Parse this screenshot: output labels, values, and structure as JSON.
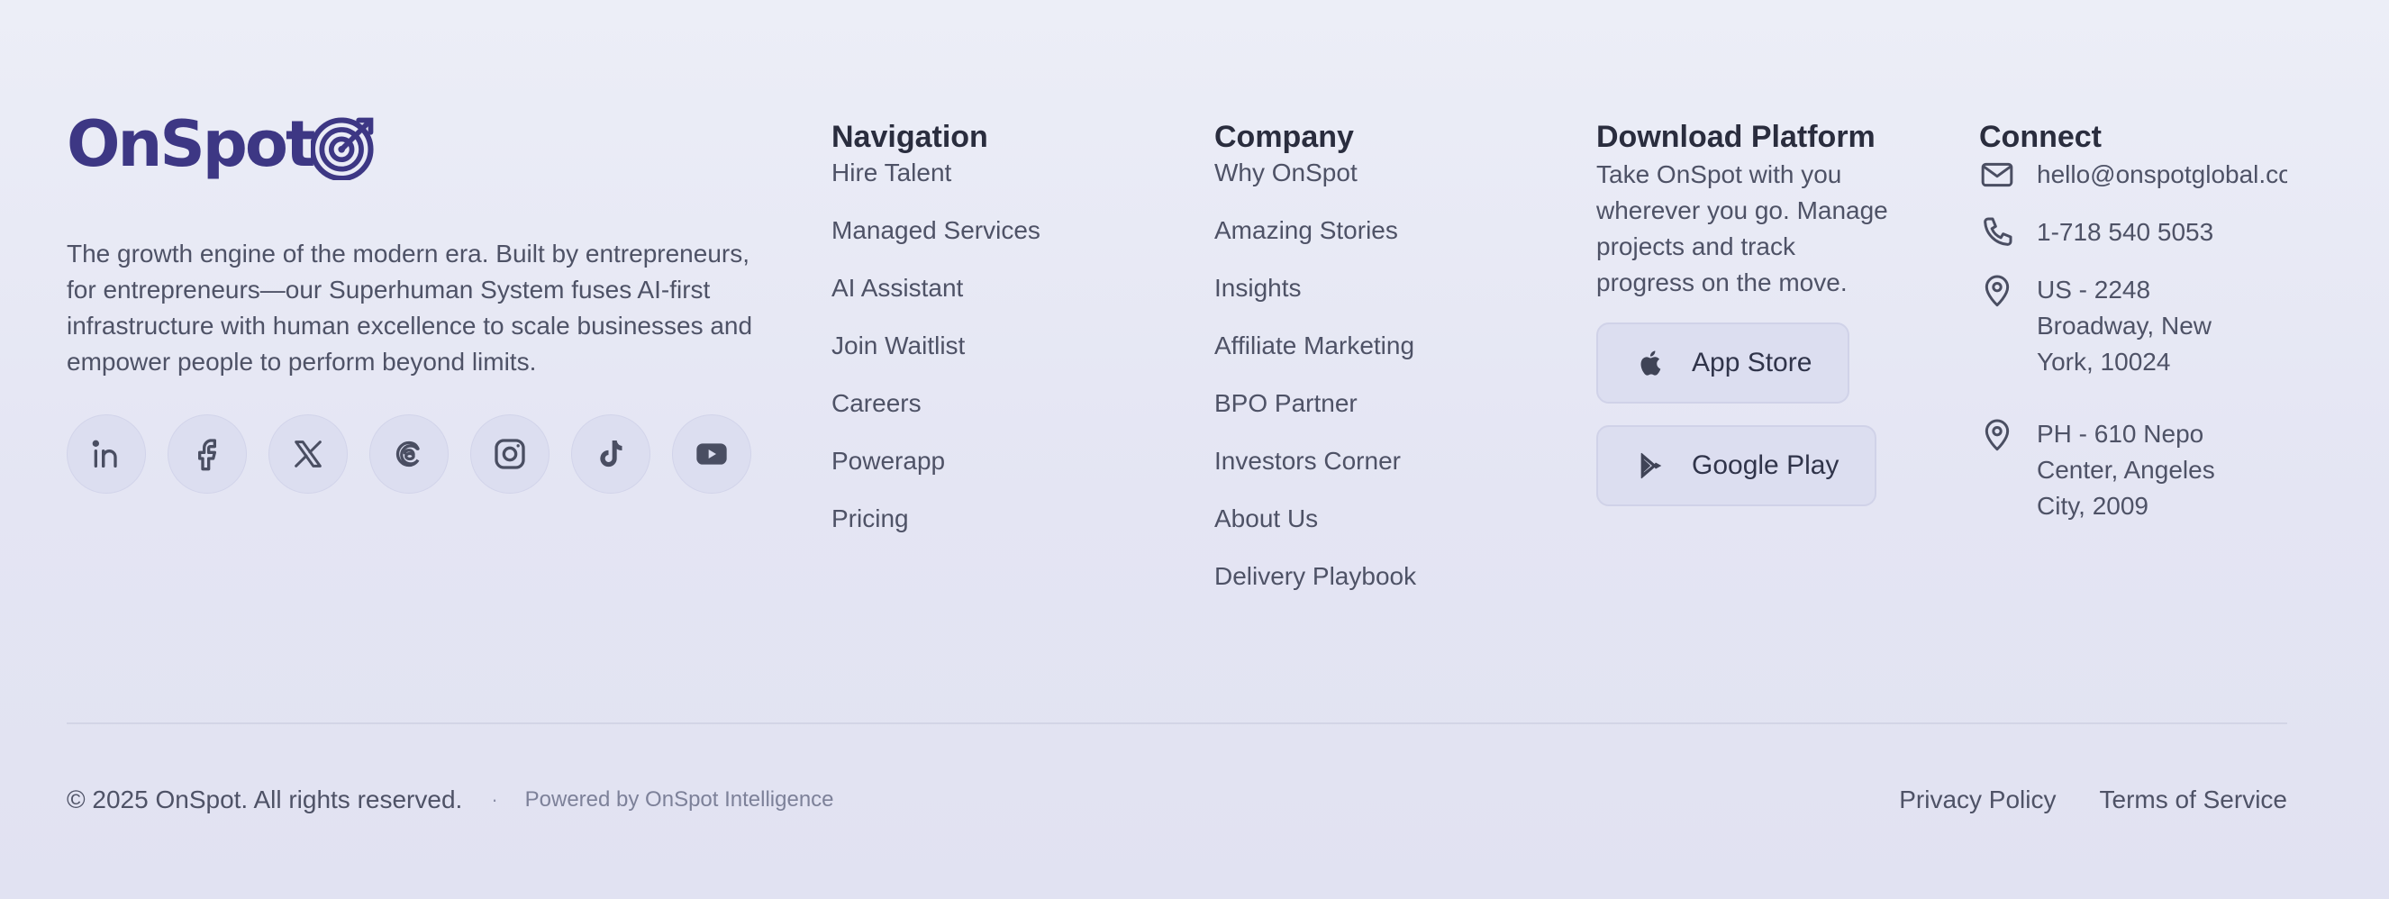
{
  "brand": {
    "logo_text": "OnSpot",
    "logo_color": "#3d3784",
    "tagline": "The growth engine of the modern era. Built by entrepreneurs, for entrepreneurs—our Superhuman System fuses AI-first infrastructure with human excellence to scale businesses and empower people to perform beyond limits.",
    "socials": [
      {
        "icon": "linkedin-icon"
      },
      {
        "icon": "facebook-icon"
      },
      {
        "icon": "x-icon"
      },
      {
        "icon": "threads-icon"
      },
      {
        "icon": "instagram-icon"
      },
      {
        "icon": "tiktok-icon"
      },
      {
        "icon": "youtube-icon"
      }
    ]
  },
  "navigation": {
    "heading": "Navigation",
    "items": [
      "Hire Talent",
      "Managed Services",
      "AI Assistant",
      "Join Waitlist",
      "Careers",
      "Powerapp",
      "Pricing"
    ]
  },
  "company": {
    "heading": "Company",
    "items": [
      "Why OnSpot",
      "Amazing Stories",
      "Insights",
      "Affiliate Marketing",
      "BPO Partner",
      "Investors Corner",
      "About Us",
      "Delivery Playbook"
    ]
  },
  "download": {
    "heading": "Download Platform",
    "description": "Take OnSpot with you wherever you go. Manage projects and track progress on the move.",
    "app_store_label": "App Store",
    "google_play_label": "Google Play"
  },
  "connect": {
    "heading": "Connect",
    "email": "hello@onspotglobal.com",
    "phone": "1-718 540 5053",
    "address_us": "US - 2248\nBroadway, New\nYork, 10024",
    "address_ph": "PH - 610 Nepo\nCenter, Angeles\nCity, 2009"
  },
  "bottom": {
    "copyright": "© 2025 OnSpot. All rights reserved.",
    "separator": "·",
    "powered_by": "Powered by OnSpot Intelligence",
    "privacy": "Privacy Policy",
    "terms": "Terms of Service"
  }
}
